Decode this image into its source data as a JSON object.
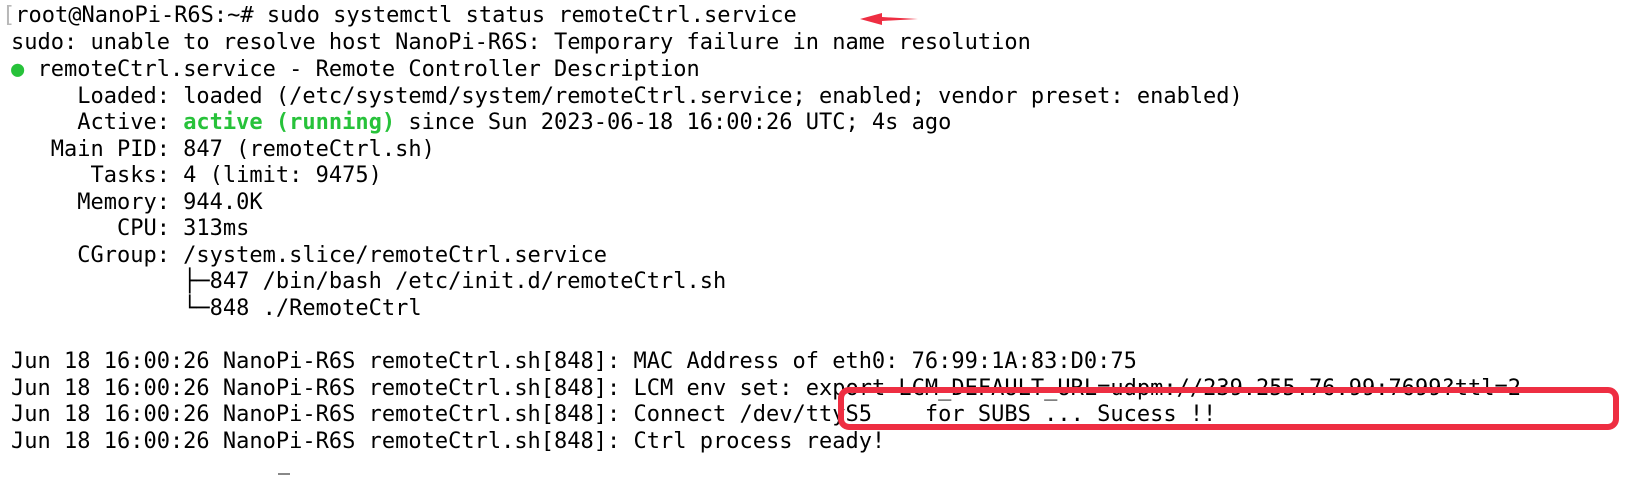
{
  "terminal": {
    "prompt_bracket": "[",
    "prompt": "root@NanoPi-R6S:~# ",
    "command": "sudo systemctl status remoteCtrl.service",
    "sudo_warning": "sudo: unable to resolve host NanoPi-R6S: Temporary failure in name resolution",
    "status_bullet": "●",
    "unit_header": " remoteCtrl.service - Remote Controller Description",
    "loaded_key": "     Loaded: ",
    "loaded_value": "loaded (/etc/systemd/system/remoteCtrl.service; enabled; vendor preset: enabled)",
    "active_key": "     Active: ",
    "active_state": "active (running)",
    "active_since": " since Sun 2023-06-18 16:00:26 UTC; 4s ago",
    "main_pid": "   Main PID: 847 (remoteCtrl.sh)",
    "tasks": "      Tasks: 4 (limit: 9475)",
    "memory": "     Memory: 944.0K",
    "cpu": "        CPU: 313ms",
    "cgroup": "     CGroup: /system.slice/remoteCtrl.service",
    "cgroup_child_1": "             ├─847 /bin/bash /etc/init.d/remoteCtrl.sh",
    "cgroup_child_2": "             └─848 ./RemoteCtrl",
    "log_1": "Jun 18 16:00:26 NanoPi-R6S remoteCtrl.sh[848]: MAC Address of eth0: 76:99:1A:83:D0:75",
    "log_2_prefix": "Jun 18 16:00:26 NanoPi-R6S remoteCtrl.sh[848]: LCM env set: ",
    "log_2_export": "export LCM_DEFAULT_URL=udpm://239.255.76.99:7699?ttl=2",
    "log_3": "Jun 18 16:00:26 NanoPi-R6S remoteCtrl.sh[848]: Connect /dev/ttyS5    for SUBS ... Sucess !!",
    "log_4": "Jun 18 16:00:26 NanoPi-R6S remoteCtrl.sh[848]: Ctrl process ready!"
  },
  "annotations": {
    "arrow_color": "#ee2e42",
    "box_color": "#ee2e42"
  },
  "colors": {
    "active_green": "#27c23a",
    "text": "#000000",
    "background": "#ffffff"
  }
}
